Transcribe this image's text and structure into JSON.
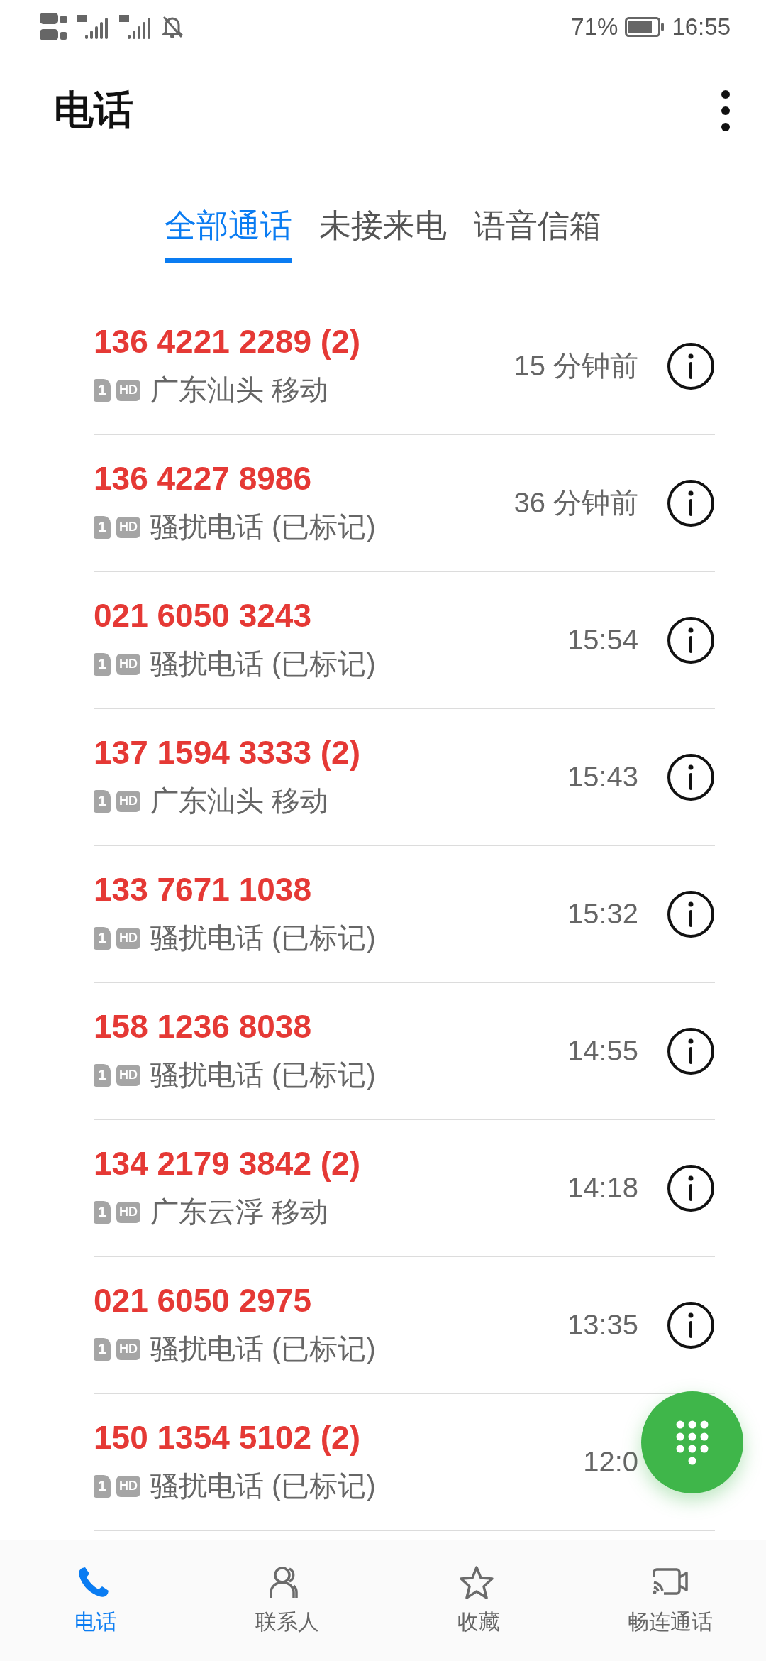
{
  "status_bar": {
    "battery": "71%",
    "time": "16:55"
  },
  "app_bar": {
    "title": "电话"
  },
  "tabs": [
    {
      "label": "全部通话",
      "selected": true
    },
    {
      "label": "未接来电",
      "selected": false
    },
    {
      "label": "语音信箱",
      "selected": false
    }
  ],
  "calls": [
    {
      "number": "136 4221 2289 (2)",
      "sim": "1",
      "hd": "HD",
      "location": "广东汕头 移动",
      "time": "15 分钟前",
      "missed": true
    },
    {
      "number": "136 4227 8986",
      "sim": "1",
      "hd": "HD",
      "location": "骚扰电话 (已标记)",
      "time": "36 分钟前",
      "missed": true
    },
    {
      "number": "021 6050 3243",
      "sim": "1",
      "hd": "HD",
      "location": "骚扰电话 (已标记)",
      "time": "15:54",
      "missed": true
    },
    {
      "number": "137 1594 3333 (2)",
      "sim": "1",
      "hd": "HD",
      "location": "广东汕头 移动",
      "time": "15:43",
      "missed": true
    },
    {
      "number": "133 7671 1038",
      "sim": "1",
      "hd": "HD",
      "location": "骚扰电话 (已标记)",
      "time": "15:32",
      "missed": true
    },
    {
      "number": "158 1236 8038",
      "sim": "1",
      "hd": "HD",
      "location": "骚扰电话 (已标记)",
      "time": "14:55",
      "missed": true
    },
    {
      "number": "134 2179 3842 (2)",
      "sim": "1",
      "hd": "HD",
      "location": "广东云浮 移动",
      "time": "14:18",
      "missed": true
    },
    {
      "number": "021 6050 2975",
      "sim": "1",
      "hd": "HD",
      "location": "骚扰电话 (已标记)",
      "time": "13:35",
      "missed": true
    },
    {
      "number": "150 1354 5102 (2)",
      "sim": "1",
      "hd": "HD",
      "location": "骚扰电话 (已标记)",
      "time": "12:0",
      "missed": true
    }
  ],
  "bottom_nav": [
    {
      "label": "电话",
      "kind": "phone",
      "selected": true
    },
    {
      "label": "联系人",
      "kind": "contacts",
      "selected": false
    },
    {
      "label": "收藏",
      "kind": "star",
      "selected": false
    },
    {
      "label": "畅连通话",
      "kind": "video",
      "selected": false
    }
  ]
}
